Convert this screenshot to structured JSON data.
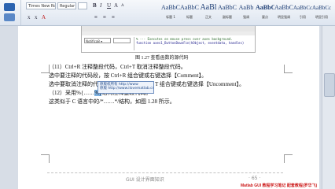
{
  "ribbon": {
    "font_name": "Times New Roman",
    "font_style": "Regular",
    "format_row1": [
      "B",
      "I",
      "U",
      "A",
      "A"
    ],
    "format_row2": [
      "x",
      "x",
      "A",
      "≡",
      "≡",
      "≡"
    ],
    "styles": [
      {
        "sample": "AaBbC",
        "label": "标题 1"
      },
      {
        "sample": "AaBbC",
        "label": "标题"
      },
      {
        "sample": "AaBl",
        "label": "正文"
      },
      {
        "sample": "AaBbC",
        "label": "副标题"
      },
      {
        "sample": "AaBb",
        "label": "强调"
      },
      {
        "sample": "AaBbC",
        "label": "要点"
      },
      {
        "sample": "AaBbC",
        "label": "明显强调"
      },
      {
        "sample": "AaBbCc",
        "label": "引用"
      },
      {
        "sample": "AaBbCc",
        "label": "明显引用"
      }
    ]
  },
  "figure": {
    "combo_value": "Notifica8 ▾",
    "code_line1": "% --- Executes on mouse press over axes background.",
    "code_line2": "function axes1_ButtonDownFcn(hObject, eventdata, handles)"
  },
  "caption": "图 1.27  查看函数的源代码",
  "paragraphs": {
    "p1": "（11）Ctrl+R 注释整段代码，Ctrl+T 取消注释整段代码。",
    "p2": "选中要注释的代码段，按 Ctrl+R 组合键或右键选择【Comment】。",
    "p3_a": "选中要取消注释的代",
    "p3_b": "T 组合键或右键选择【Uncomment】。",
    "p4_a": "（12）采用%{……",
    "p4_hl": "%}",
    "p4_b": "结构注释整段代码。",
    "p5_a": "这类似于 C 语言中的/*……*/",
    "p5_b": "结构，如图 1.28 所示。"
  },
  "tooltip": {
    "line1": "原版权所有 http://www",
    "line2": "原版 http://www.ilovematlab.cn"
  },
  "footer": {
    "center": "GUI 设计界面知识",
    "page": "· 65 ·"
  },
  "watermark": "Matlab GUI 教程学习笔记 配套教程(罗华飞)"
}
